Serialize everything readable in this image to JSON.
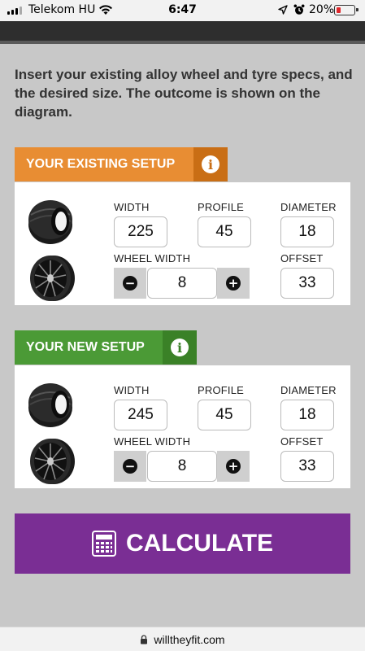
{
  "status_bar": {
    "carrier": "Telekom HU",
    "time": "6:47",
    "battery": "20%",
    "battery_level": 0.2,
    "icons": [
      "signal-icon",
      "wifi-icon",
      "location-arrow-icon",
      "alarm-icon",
      "battery-icon"
    ]
  },
  "intro": "Insert your existing alloy wheel and tyre specs, and the desired size. The outcome is shown on the diagram.",
  "existing": {
    "title": "YOUR EXISTING SETUP",
    "info_icon": "i",
    "labels": {
      "width": "WIDTH",
      "profile": "PROFILE",
      "diameter": "DIAMETER",
      "wheel_width": "WHEEL WIDTH",
      "offset": "OFFSET"
    },
    "values": {
      "width": "225",
      "profile": "45",
      "diameter": "18",
      "wheel_width": "8",
      "offset": "33"
    }
  },
  "new": {
    "title": "YOUR NEW SETUP",
    "info_icon": "i",
    "labels": {
      "width": "WIDTH",
      "profile": "PROFILE",
      "diameter": "DIAMETER",
      "wheel_width": "WHEEL WIDTH",
      "offset": "OFFSET"
    },
    "values": {
      "width": "245",
      "profile": "45",
      "diameter": "18",
      "wheel_width": "8",
      "offset": "33"
    }
  },
  "stepper": {
    "minus": "−",
    "plus": "+"
  },
  "calculate": {
    "label": "CALCULATE",
    "icon": "calculator-icon"
  },
  "url": "willtheyfit.com",
  "colors": {
    "existing_accent": "#e88d33",
    "new_accent": "#4b9a36",
    "calculate": "#7a2e94",
    "background": "#c8c8c8"
  }
}
